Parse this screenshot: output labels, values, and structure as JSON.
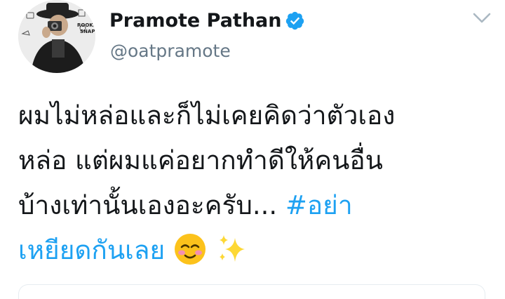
{
  "tweet": {
    "display_name": "Pramote Pathan",
    "handle": "@oatpramote",
    "lines": [
      "ผมไม่หล่อและก็ไม่เคยคิดว่าตัวเอง",
      "หล่อ แต่ผมแค่อยากทำดีให้คนอื่น",
      "บ้างเท่านั้นเองอะครับ... "
    ],
    "hashtag_part1": "#อย่า",
    "hashtag_part2": "เหยียดกันเลย",
    "avatar_badge": "ROOKIE SNAP"
  },
  "icons": {
    "verified": "verified-badge-icon",
    "more": "chevron-down-icon",
    "emoji1": "smiling-face-with-blush-emoji",
    "emoji2": "sparkles-emoji"
  },
  "colors": {
    "link": "#1da1f2",
    "secondary_text": "#657786",
    "verified": "#1da1f2"
  }
}
